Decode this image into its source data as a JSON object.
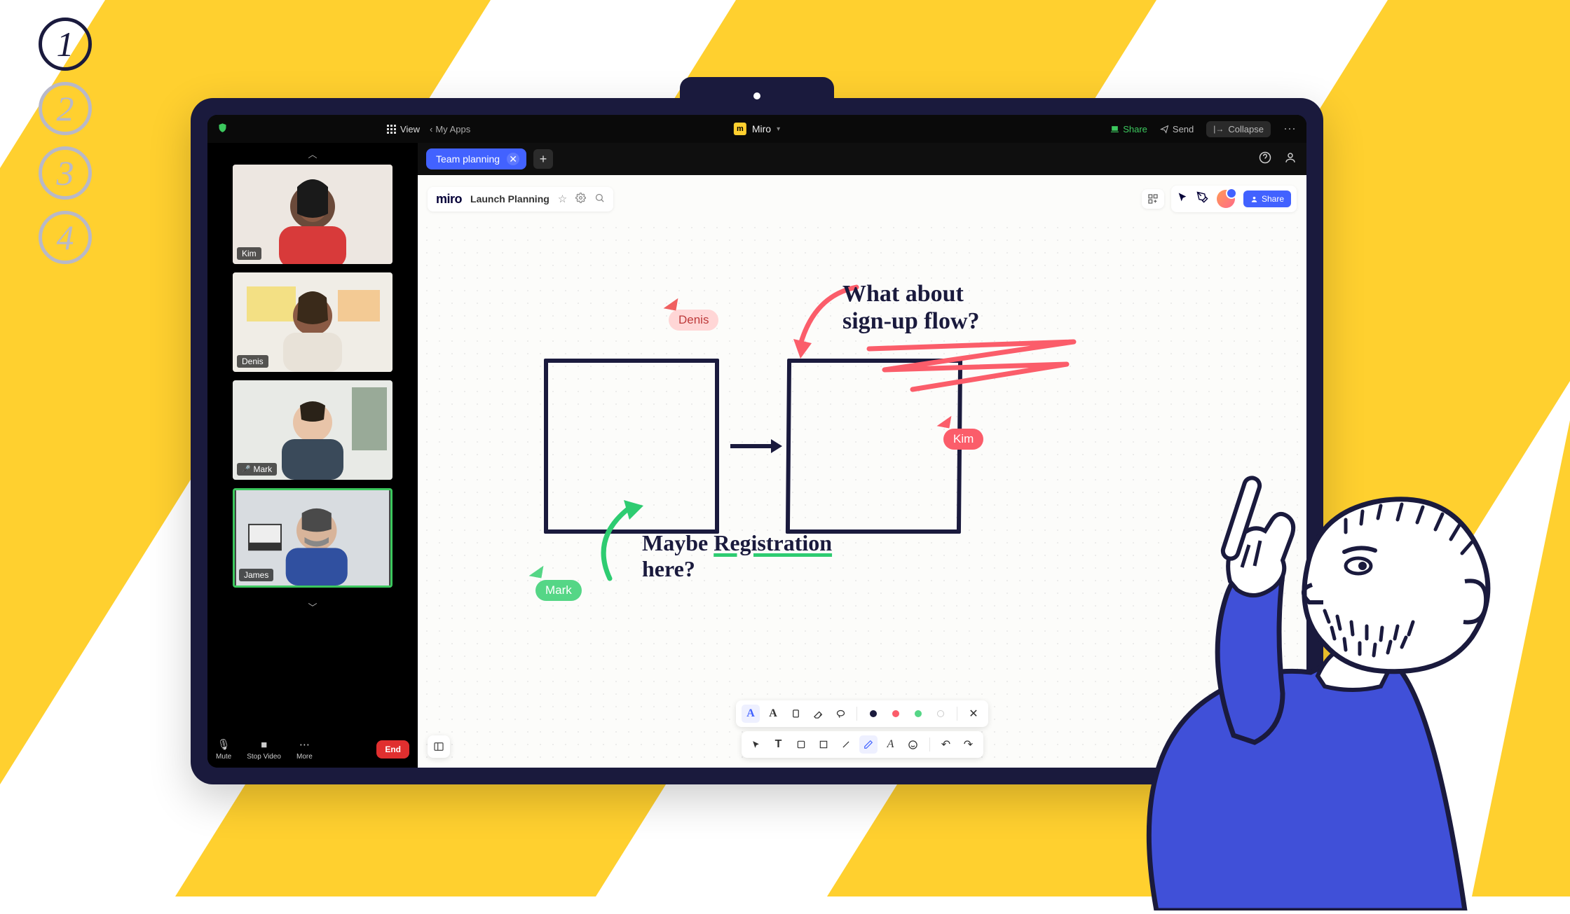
{
  "steps": [
    "1",
    "2",
    "3",
    "4"
  ],
  "active_step": 0,
  "zoom_topbar": {
    "view_label": "View",
    "back_label": "My Apps",
    "app_name": "Miro",
    "share_label": "Share",
    "send_label": "Send",
    "collapse_label": "Collapse"
  },
  "video_sidebar": {
    "participants": [
      {
        "name": "Kim",
        "muted": false,
        "active": false
      },
      {
        "name": "Denis",
        "muted": false,
        "active": false
      },
      {
        "name": "Mark",
        "muted": true,
        "active": false
      },
      {
        "name": "James",
        "muted": false,
        "active": true
      }
    ],
    "controls": {
      "mute": "Mute",
      "stop_video": "Stop Video",
      "more": "More",
      "end": "End"
    }
  },
  "tabbar": {
    "tab_label": "Team planning"
  },
  "miro": {
    "wordmark": "miro",
    "board_name": "Launch Planning",
    "share_label": "Share"
  },
  "canvas": {
    "cursors": {
      "denis": "Denis",
      "kim": "Kim",
      "mark": "Mark"
    },
    "annotations": {
      "what_about_1": "What about",
      "what_about_2": "sign-up flow?",
      "maybe_1": "Maybe ",
      "maybe_reg": "Registration",
      "maybe_2": "here?"
    }
  },
  "toolbar_icons": {
    "pen": "A",
    "marker": "A",
    "hl": "◻",
    "lasso": "◯",
    "eraser": "⌫",
    "dots": "⋯",
    "close": "✕",
    "cursor": "↖",
    "text": "T",
    "shape": "◻",
    "line": "╲",
    "draw": "✎",
    "letter": "A",
    "face": "☺",
    "undo": "↶",
    "redo": "↷"
  }
}
